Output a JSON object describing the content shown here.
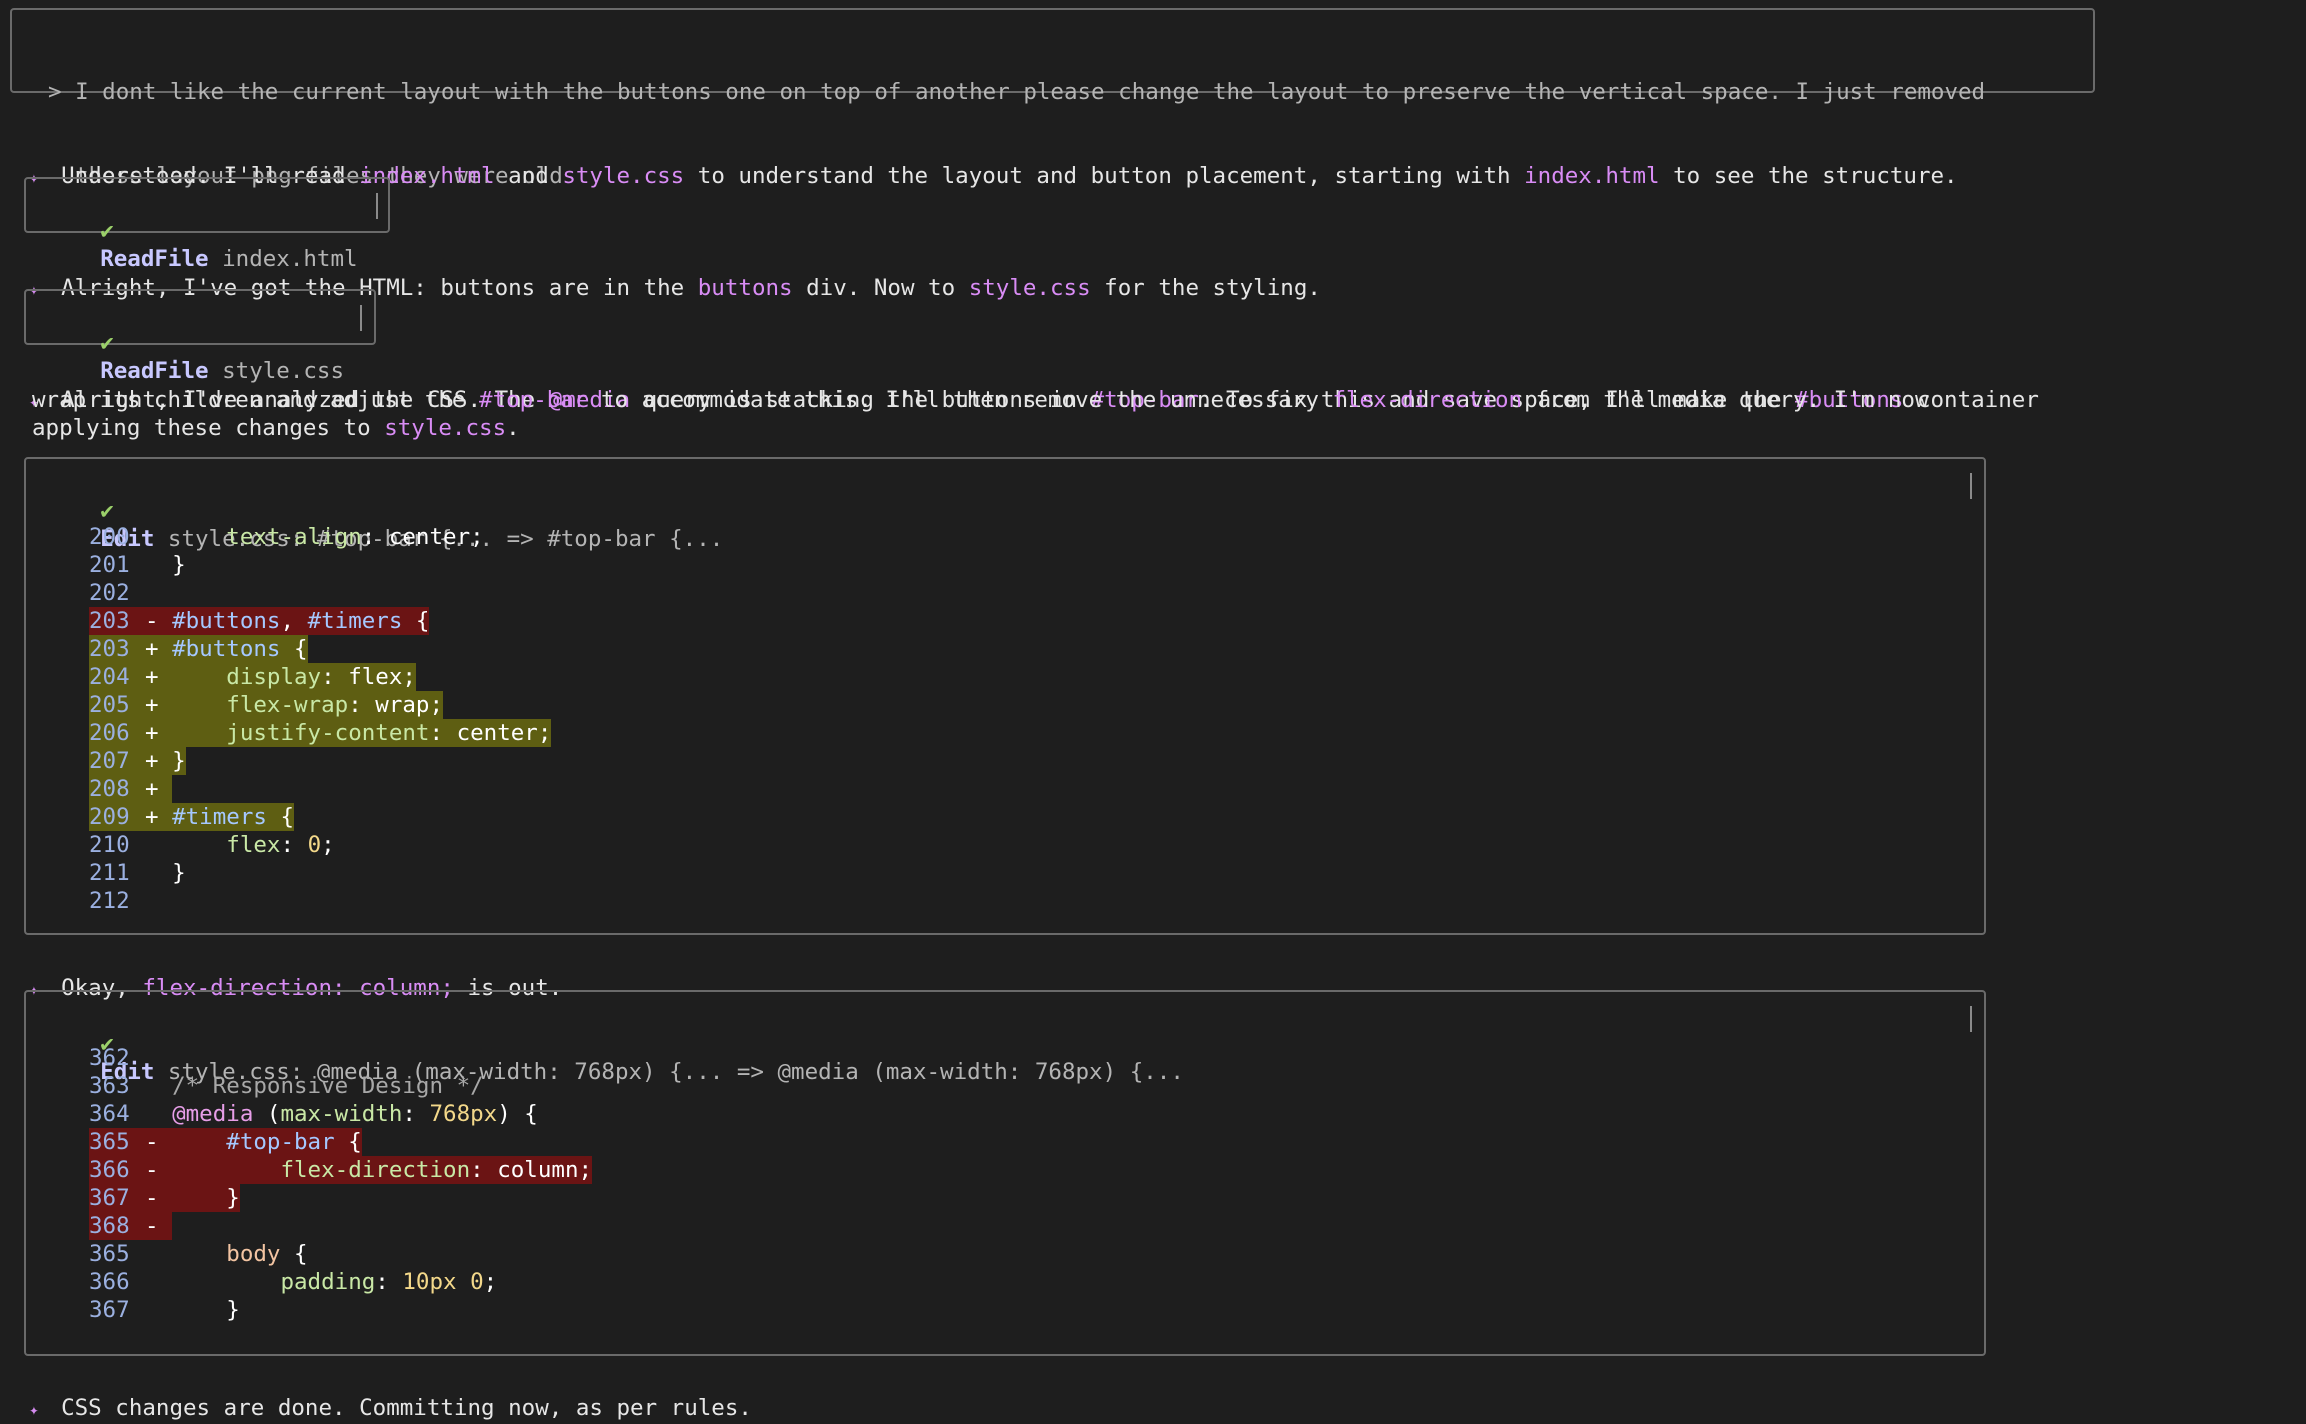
{
  "prompt": {
    "line1": "> I dont like the current layout with the buttons one on top of another please change the layout to preserve the vertical space. I just removed",
    "line2": "  those layout png files they were old"
  },
  "messages": {
    "m1": {
      "p1": "Understood. I'll read ",
      "f1": "index.html",
      "p2": " and ",
      "f2": "style.css",
      "p3": " to understand the layout and button placement, starting with ",
      "f3": "index.html",
      "p4": " to see the structure."
    },
    "m2": {
      "p1": "Alright, I've got the HTML: buttons are in the ",
      "f1": "buttons",
      "p2": " div. Now to ",
      "f2": "style.css",
      "p3": " for the styling."
    },
    "m3": {
      "p1": "Alright, I've analyzed the CSS. The ",
      "f1": "@media",
      "p2": " query is stacking the buttons in ",
      "f2": "#top-bar",
      "p3": ". To fix this and save space, I'll make the ",
      "f3": "#buttons",
      "p4": " container",
      "l2p1": "wrap its children and adjust the ",
      "l2f1": "#top-bar",
      "l2p2": " to accommodate this. I'll then remove the unnecessary ",
      "l2f2": "flex-direction",
      "l2p3": " from the media query. I'm now",
      "l3p1": "applying these changes to ",
      "l3f1": "style.css",
      "l3p2": "."
    },
    "m4": {
      "p1": "Okay, ",
      "f1": "flex-direction: column;",
      "p2": " is out."
    },
    "m5": {
      "p1": "CSS changes are done. Committing now, as per rules."
    }
  },
  "tools": {
    "t1": {
      "check": "✔",
      "name": "ReadFile",
      "desc": " index.html"
    },
    "t2": {
      "check": "✔",
      "name": "ReadFile",
      "desc": " style.css"
    },
    "t3": {
      "check": "✔",
      "name": "Edit",
      "desc": " style.css: #top-bar {... => #top-bar {..."
    },
    "t4": {
      "check": "✔",
      "name": "Edit",
      "desc": " style.css: @media (max-width: 768px) {... => @media (max-width: 768px) {..."
    }
  },
  "diff1": [
    {
      "n": "200",
      "m": " ",
      "segs": [
        [
          "    ",
          "pun"
        ],
        [
          "text-align",
          "prop"
        ],
        [
          ": ",
          "pun"
        ],
        [
          "center",
          "val"
        ],
        [
          ";",
          "pun"
        ]
      ]
    },
    {
      "n": "201",
      "m": " ",
      "segs": [
        [
          "}",
          "pun"
        ]
      ]
    },
    {
      "n": "202",
      "m": " ",
      "segs": []
    },
    {
      "n": "203",
      "m": "-",
      "segs": [
        [
          "#buttons",
          "sel"
        ],
        [
          ", ",
          "pun"
        ],
        [
          "#timers",
          "sel"
        ],
        [
          " {",
          "pun"
        ]
      ]
    },
    {
      "n": "203",
      "m": "+",
      "segs": [
        [
          "#buttons",
          "sel"
        ],
        [
          " {",
          "pun"
        ]
      ]
    },
    {
      "n": "204",
      "m": "+",
      "segs": [
        [
          "    ",
          "pun"
        ],
        [
          "display",
          "prop"
        ],
        [
          ": ",
          "pun"
        ],
        [
          "flex",
          "val"
        ],
        [
          ";",
          "pun"
        ]
      ]
    },
    {
      "n": "205",
      "m": "+",
      "segs": [
        [
          "    ",
          "pun"
        ],
        [
          "flex-wrap",
          "prop"
        ],
        [
          ": ",
          "pun"
        ],
        [
          "wrap",
          "val"
        ],
        [
          ";",
          "pun"
        ]
      ]
    },
    {
      "n": "206",
      "m": "+",
      "segs": [
        [
          "    ",
          "pun"
        ],
        [
          "justify-content",
          "prop"
        ],
        [
          ": ",
          "pun"
        ],
        [
          "center",
          "val"
        ],
        [
          ";",
          "pun"
        ]
      ]
    },
    {
      "n": "207",
      "m": "+",
      "segs": [
        [
          "}",
          "pun"
        ]
      ]
    },
    {
      "n": "208",
      "m": "+",
      "segs": []
    },
    {
      "n": "209",
      "m": "+",
      "segs": [
        [
          "#timers",
          "sel"
        ],
        [
          " {",
          "pun"
        ]
      ]
    },
    {
      "n": "210",
      "m": " ",
      "segs": [
        [
          "    ",
          "pun"
        ],
        [
          "flex",
          "prop"
        ],
        [
          ": ",
          "pun"
        ],
        [
          "0",
          "num"
        ],
        [
          ";",
          "pun"
        ]
      ]
    },
    {
      "n": "211",
      "m": " ",
      "segs": [
        [
          "}",
          "pun"
        ]
      ]
    },
    {
      "n": "212",
      "m": " ",
      "segs": []
    }
  ],
  "diff2": [
    {
      "n": "362",
      "m": " ",
      "segs": []
    },
    {
      "n": "363",
      "m": " ",
      "segs": [
        [
          "/* Responsive Design */",
          "com"
        ]
      ]
    },
    {
      "n": "364",
      "m": " ",
      "segs": [
        [
          "@media",
          "at"
        ],
        [
          " (",
          "pun"
        ],
        [
          "max-width",
          "prop"
        ],
        [
          ": ",
          "pun"
        ],
        [
          "768px",
          "num"
        ],
        [
          ") {",
          "pun"
        ]
      ]
    },
    {
      "n": "365",
      "m": "-",
      "segs": [
        [
          "    ",
          "pun"
        ],
        [
          "#top-bar",
          "sel"
        ],
        [
          " {",
          "pun"
        ]
      ]
    },
    {
      "n": "366",
      "m": "-",
      "segs": [
        [
          "        ",
          "pun"
        ],
        [
          "flex-direction",
          "prop"
        ],
        [
          ": ",
          "pun"
        ],
        [
          "column",
          "val"
        ],
        [
          ";",
          "pun"
        ]
      ]
    },
    {
      "n": "367",
      "m": "-",
      "segs": [
        [
          "    }",
          "pun"
        ]
      ]
    },
    {
      "n": "368",
      "m": "-",
      "segs": []
    },
    {
      "n": "365",
      "m": " ",
      "segs": [
        [
          "    ",
          "pun"
        ],
        [
          "body",
          "tag"
        ],
        [
          " {",
          "pun"
        ]
      ]
    },
    {
      "n": "366",
      "m": " ",
      "segs": [
        [
          "        ",
          "pun"
        ],
        [
          "padding",
          "prop"
        ],
        [
          ": ",
          "pun"
        ],
        [
          "10px",
          "num"
        ],
        [
          " ",
          "pun"
        ],
        [
          "0",
          "num"
        ],
        [
          ";",
          "pun"
        ]
      ]
    },
    {
      "n": "367",
      "m": " ",
      "segs": [
        [
          "    }",
          "pun"
        ]
      ]
    }
  ]
}
